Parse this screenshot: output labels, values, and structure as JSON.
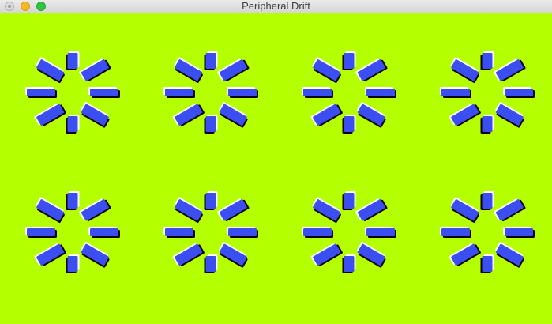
{
  "window": {
    "title": "Peripheral Drift"
  },
  "canvas": {
    "background_color": "#b4ff00",
    "tile_color": "#3b4ef2",
    "shadow_light": "#ffffff",
    "shadow_dark": "#000000",
    "flower_rows": 2,
    "flower_columns": 4,
    "elements_per_flower": 8
  }
}
